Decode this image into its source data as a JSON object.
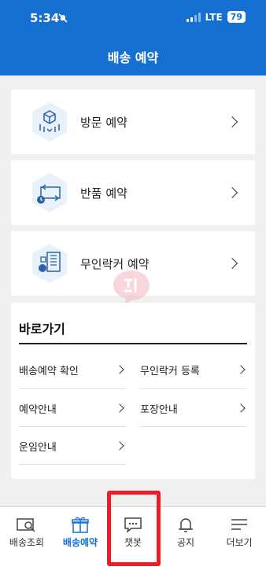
{
  "status_bar": {
    "time": "5:34",
    "network": "LTE",
    "battery": "79"
  },
  "header": {
    "title": "배송 예약"
  },
  "menu": [
    {
      "label": "방문 예약",
      "icon": "box-pickup-icon"
    },
    {
      "label": "반품 예약",
      "icon": "return-icon"
    },
    {
      "label": "무인락커 예약",
      "icon": "locker-icon"
    }
  ],
  "shortcuts": {
    "title": "바로가기",
    "items": [
      {
        "label": "배송예약 확인"
      },
      {
        "label": "무인락커 등록"
      },
      {
        "label": "예약안내"
      },
      {
        "label": "포장안내"
      },
      {
        "label": "운임안내"
      }
    ]
  },
  "tabs": [
    {
      "label": "배송조회",
      "icon": "search-box-icon"
    },
    {
      "label": "배송예약",
      "icon": "gift-box-icon",
      "active": true
    },
    {
      "label": "챗봇",
      "icon": "chat-bubble-icon"
    },
    {
      "label": "공지",
      "icon": "bell-icon"
    },
    {
      "label": "더보기",
      "icon": "menu-lines-icon"
    }
  ],
  "colors": {
    "brand_blue": "#1570d2",
    "highlight_red": "#ee1c25",
    "icon_bg": "#e9f1fb"
  }
}
